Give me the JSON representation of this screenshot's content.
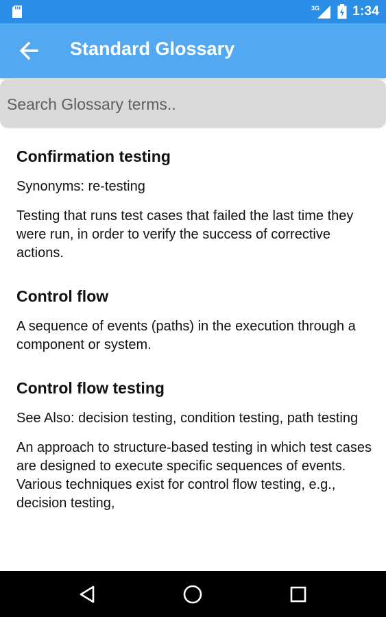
{
  "status_bar": {
    "network_label": "3G",
    "time": "1:34",
    "icons": [
      "sd-card-icon",
      "signal-icon",
      "battery-icon"
    ]
  },
  "app_bar": {
    "title": "Standard Glossary",
    "back_icon": "arrow-back-icon",
    "color": "#53a9f1"
  },
  "search": {
    "placeholder": "Search Glossary terms..",
    "value": ""
  },
  "glossary": {
    "terms": [
      {
        "title": "Confirmation testing",
        "note": "Synonyms: re-testing",
        "definition": "Testing that runs test cases that failed the last time they were run, in order to verify the success of corrective actions."
      },
      {
        "title": "Control flow",
        "definition": "A sequence of events (paths) in the execution through a component or system."
      },
      {
        "title": "Control flow testing",
        "note": "See Also: decision testing, condition testing, path testing",
        "definition": "An approach to structure-based testing in which test cases are designed to execute specific sequences of events. Various techniques exist for control flow testing, e.g., decision testing,"
      }
    ]
  },
  "nav_bar": {
    "buttons": [
      "back-triangle-icon",
      "home-circle-icon",
      "recents-square-icon"
    ]
  }
}
